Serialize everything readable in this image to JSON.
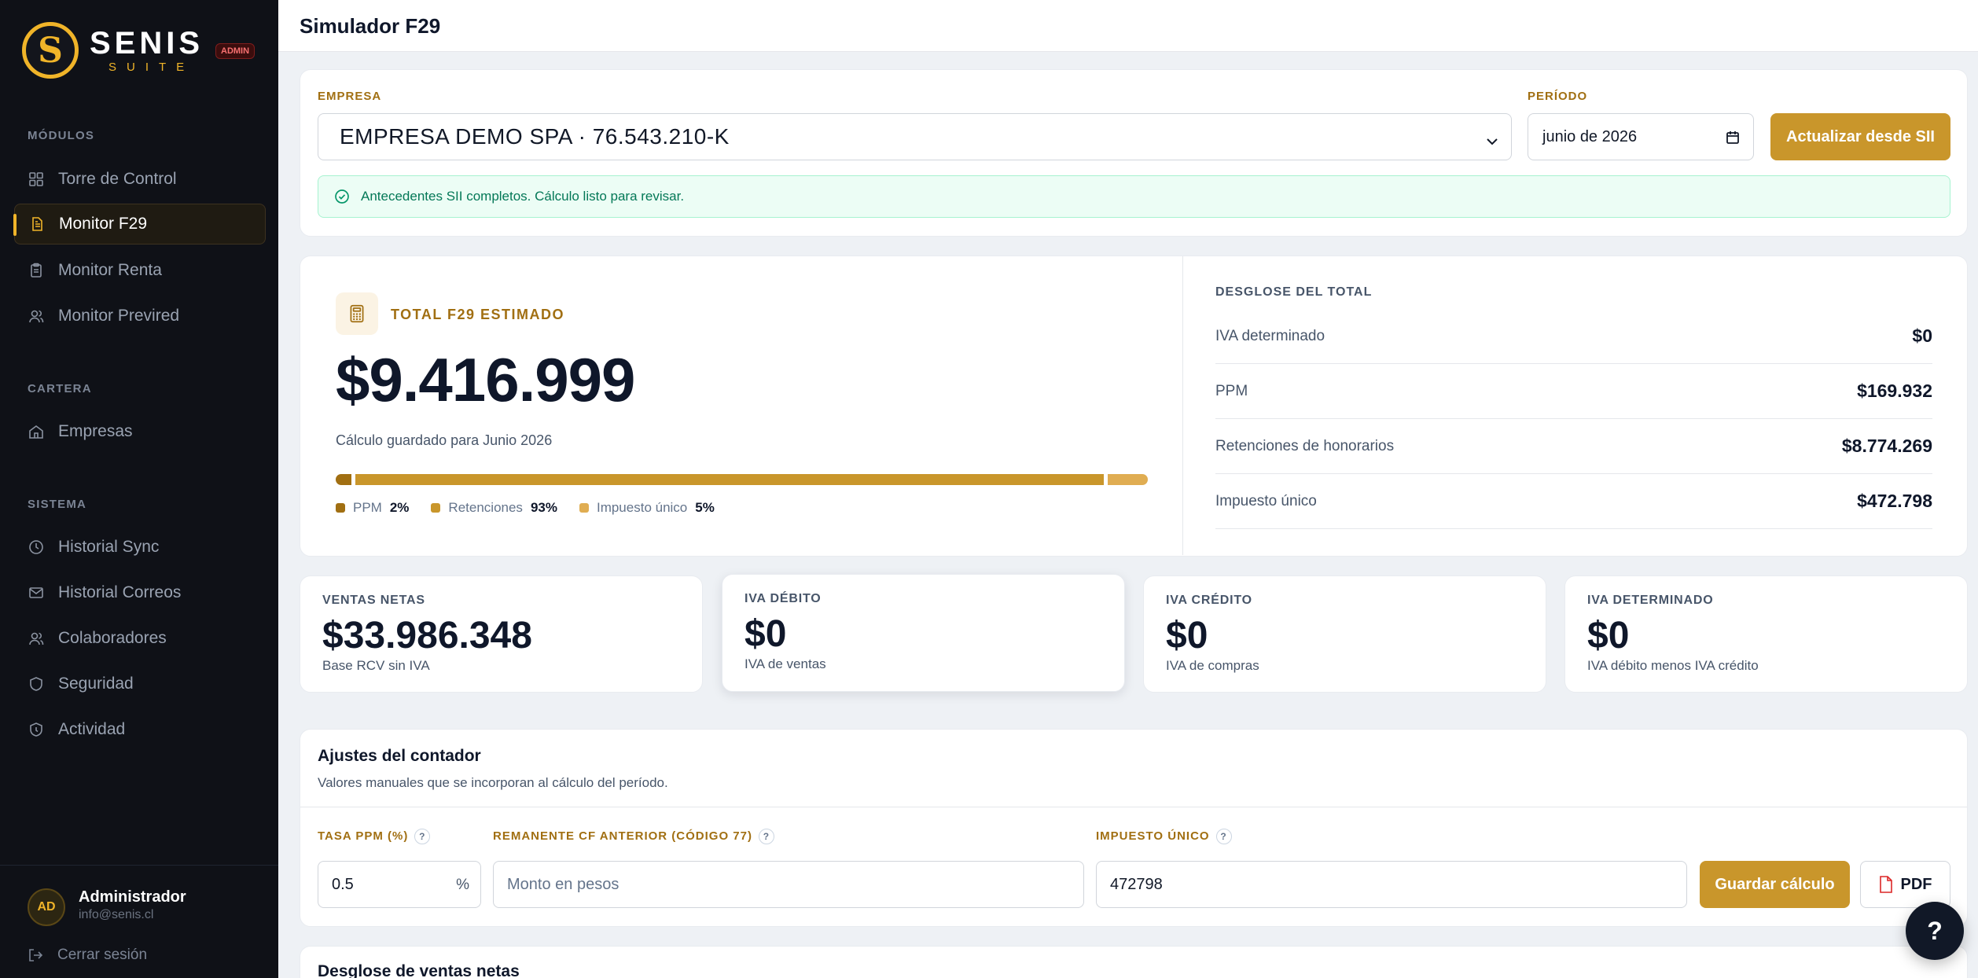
{
  "brand": {
    "name": "SENIS",
    "sub": "SUITE",
    "logo_letter": "S",
    "badge": "ADMIN",
    "accent": "#f0b429"
  },
  "sidebar": {
    "sections": [
      {
        "label": "MÓDULOS",
        "items": [
          {
            "label": "Torre de Control",
            "icon": "grid-icon"
          },
          {
            "label": "Monitor F29",
            "icon": "document-icon",
            "active": true
          },
          {
            "label": "Monitor Renta",
            "icon": "clipboard-icon"
          },
          {
            "label": "Monitor Previred",
            "icon": "users-icon"
          }
        ]
      },
      {
        "label": "CARTERA",
        "items": [
          {
            "label": "Empresas",
            "icon": "home-icon"
          }
        ]
      },
      {
        "label": "SISTEMA",
        "items": [
          {
            "label": "Historial Sync",
            "icon": "clock-icon"
          },
          {
            "label": "Historial Correos",
            "icon": "mail-icon"
          },
          {
            "label": "Colaboradores",
            "icon": "users-icon"
          },
          {
            "label": "Seguridad",
            "icon": "shield-icon"
          },
          {
            "label": "Actividad",
            "icon": "activity-icon"
          }
        ]
      }
    ],
    "user": {
      "initials": "AD",
      "name": "Administrador",
      "email": "info@senis.cl"
    },
    "logout": "Cerrar sesión"
  },
  "header": {
    "title": "Simulador F29"
  },
  "filters": {
    "empresa_label": "EMPRESA",
    "empresa_value": "EMPRESA DEMO SPA · 76.543.210-K",
    "periodo_label": "PERÍODO",
    "periodo_value": "junio de 2026",
    "update_button": "Actualizar desde SII",
    "alert": "Antecedentes SII completos. Cálculo listo para revisar."
  },
  "total": {
    "label": "TOTAL F29 ESTIMADO",
    "value": "$9.416.999",
    "caption": "Cálculo guardado para Junio 2026",
    "segments": [
      {
        "name": "PPM",
        "pct": "2%",
        "share": 0.02,
        "color": "#a16f12"
      },
      {
        "name": "Retenciones",
        "pct": "93%",
        "share": 0.93,
        "color": "#c9962b"
      },
      {
        "name": "Impuesto único",
        "pct": "5%",
        "share": 0.05,
        "color": "#e0ad52"
      }
    ]
  },
  "breakdown": {
    "title": "DESGLOSE DEL TOTAL",
    "rows": [
      {
        "label": "IVA determinado",
        "value": "$0"
      },
      {
        "label": "PPM",
        "value": "$169.932"
      },
      {
        "label": "Retenciones de honorarios",
        "value": "$8.774.269"
      },
      {
        "label": "Impuesto único",
        "value": "$472.798"
      }
    ]
  },
  "kpis": [
    {
      "label": "VENTAS NETAS",
      "value": "$33.986.348",
      "sub": "Base RCV sin IVA"
    },
    {
      "label": "IVA DÉBITO",
      "value": "$0",
      "sub": "IVA de ventas"
    },
    {
      "label": "IVA CRÉDITO",
      "value": "$0",
      "sub": "IVA de compras"
    },
    {
      "label": "IVA DETERMINADO",
      "value": "$0",
      "sub": "IVA débito menos IVA crédito"
    }
  ],
  "ajustes": {
    "title": "Ajustes del contador",
    "subtitle": "Valores manuales que se incorporan al cálculo del período.",
    "ppm_label": "TASA PPM (%)",
    "ppm_value": "0.5",
    "ppm_suffix": "%",
    "remanente_label": "REMANENTE CF ANTERIOR (CÓDIGO 77)",
    "remanente_placeholder": "Monto en pesos",
    "impuesto_label": "IMPUESTO ÚNICO",
    "impuesto_value": "472798",
    "help": "?",
    "save_button": "Guardar cálculo",
    "pdf_button": "PDF"
  },
  "next_section": {
    "title": "Desglose de ventas netas"
  },
  "fab": "?"
}
